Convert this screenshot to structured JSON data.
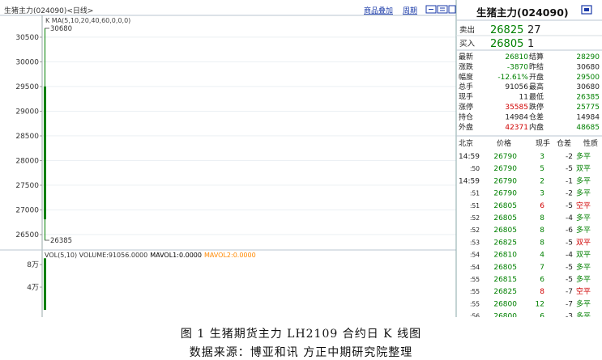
{
  "header": {
    "title": "生猪主力(024090)<日线>",
    "menu_add": "商品叠加",
    "menu_cycle": "周期",
    "quote_title": "生猪主力(024090)"
  },
  "kline": {
    "ma_label": "K  MA(5,10,20,40,60,0,0,0)",
    "vol_label": "VOL(5,10) VOLUME:91056.0000",
    "mavol1_label": "MAVOL1:0.0000",
    "mavol2_label": "MAVOL2:0.0000",
    "high_label": "30680",
    "low_label": "26385"
  },
  "colors": {
    "up": "#d00000",
    "down": "#008000",
    "bg": "#ffffff",
    "grid": "#dfe8ee",
    "accent": "#ff8800"
  },
  "chart_data": {
    "type": "candlestick",
    "price_axis": {
      "ticks": [
        30500,
        30000,
        29500,
        29000,
        28500,
        28000,
        27500,
        27000,
        26500
      ],
      "labels": [
        "30500",
        "30000",
        "29500",
        "29000",
        "28500",
        "28000",
        "27500",
        "27000",
        "26500"
      ],
      "ylim": [
        26300,
        30900
      ]
    },
    "volume_axis": {
      "ticks": [
        80000,
        40000
      ],
      "labels": [
        "8万",
        "4万"
      ],
      "ylim": [
        0,
        100000
      ]
    },
    "candles": [
      {
        "open": 29500,
        "high": 30680,
        "low": 26385,
        "close": 26810,
        "volume": 91056
      }
    ]
  },
  "quote": {
    "sell": {
      "label": "卖出",
      "price": "26825",
      "qty": "27"
    },
    "buy": {
      "label": "买入",
      "price": "26805",
      "qty": "1"
    },
    "stats": [
      {
        "l1": "最新",
        "v1": "26810",
        "c1": "#008000",
        "l2": "结算",
        "v2": "28290",
        "c2": "#008000"
      },
      {
        "l1": "涨跌",
        "v1": "-3870",
        "c1": "#008000",
        "l2": "昨结",
        "v2": "30680",
        "c2": "#222222"
      },
      {
        "l1": "幅度",
        "v1": "-12.61%",
        "c1": "#008000",
        "l2": "开盘",
        "v2": "29500",
        "c2": "#008000"
      },
      {
        "l1": "总手",
        "v1": "91056",
        "c1": "#222222",
        "l2": "最高",
        "v2": "30680",
        "c2": "#222222"
      },
      {
        "l1": "现手",
        "v1": "11",
        "c1": "#222222",
        "l2": "最低",
        "v2": "26385",
        "c2": "#008000"
      },
      {
        "l1": "涨停",
        "v1": "35585",
        "c1": "#d00000",
        "l2": "跌停",
        "v2": "25775",
        "c2": "#008000"
      },
      {
        "l1": "持仓",
        "v1": "14984",
        "c1": "#222222",
        "l2": "仓差",
        "v2": "14984",
        "c2": "#222222"
      },
      {
        "l1": "外盘",
        "v1": "42371",
        "c1": "#d00000",
        "l2": "内盘",
        "v2": "48685",
        "c2": "#008000"
      }
    ],
    "trade_headers": [
      "北京",
      "价格",
      "现手",
      "仓差",
      "性质"
    ],
    "trades": [
      {
        "time": "14:59",
        "price": "26790",
        "qty": "3",
        "qc": "#008000",
        "diff": "-2",
        "nature": "多平",
        "nc": "#008000"
      },
      {
        "time": ":50",
        "price": "26790",
        "qty": "5",
        "qc": "#008000",
        "diff": "-5",
        "nature": "双平",
        "nc": "#008000"
      },
      {
        "time": "14:59",
        "price": "26790",
        "qty": "2",
        "qc": "#008000",
        "diff": "-1",
        "nature": "多平",
        "nc": "#008000"
      },
      {
        "time": ":51",
        "price": "26790",
        "qty": "3",
        "qc": "#008000",
        "diff": "-2",
        "nature": "多平",
        "nc": "#008000"
      },
      {
        "time": ":51",
        "price": "26805",
        "qty": "6",
        "qc": "#d00000",
        "diff": "-5",
        "nature": "空平",
        "nc": "#d00000"
      },
      {
        "time": ":52",
        "price": "26805",
        "qty": "8",
        "qc": "#008000",
        "diff": "-4",
        "nature": "多平",
        "nc": "#008000"
      },
      {
        "time": ":52",
        "price": "26805",
        "qty": "8",
        "qc": "#008000",
        "diff": "-6",
        "nature": "多平",
        "nc": "#008000"
      },
      {
        "time": ":53",
        "price": "26825",
        "qty": "8",
        "qc": "#008000",
        "diff": "-5",
        "nature": "双平",
        "nc": "#d00000"
      },
      {
        "time": ":54",
        "price": "26810",
        "qty": "4",
        "qc": "#008000",
        "diff": "-4",
        "nature": "双平",
        "nc": "#008000"
      },
      {
        "time": ":54",
        "price": "26805",
        "qty": "7",
        "qc": "#008000",
        "diff": "-5",
        "nature": "多平",
        "nc": "#008000"
      },
      {
        "time": ":55",
        "price": "26815",
        "qty": "6",
        "qc": "#008000",
        "diff": "-5",
        "nature": "多平",
        "nc": "#008000"
      },
      {
        "time": ":55",
        "price": "26825",
        "qty": "8",
        "qc": "#d00000",
        "diff": "-7",
        "nature": "空平",
        "nc": "#d00000"
      },
      {
        "time": ":55",
        "price": "26800",
        "qty": "12",
        "qc": "#008000",
        "diff": "-7",
        "nature": "多平",
        "nc": "#008000"
      },
      {
        "time": ":56",
        "price": "26800",
        "qty": "6",
        "qc": "#008000",
        "diff": "-3",
        "nature": "多平",
        "nc": "#008000"
      }
    ]
  },
  "caption": {
    "line1": "图 1   生猪期货主力 LH2109 合约日 K 线图",
    "line2": "数据来源：博亚和讯 方正中期研究院整理"
  }
}
